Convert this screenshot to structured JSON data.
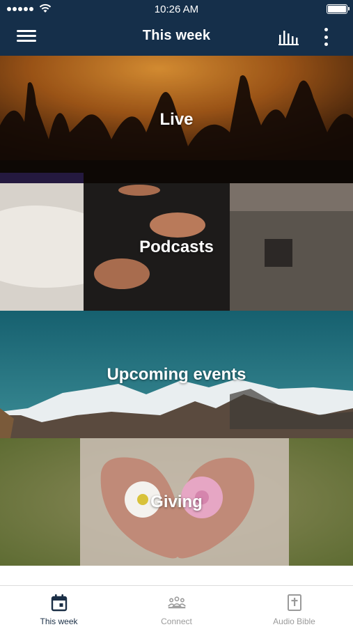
{
  "status_bar": {
    "time": "10:26 AM"
  },
  "nav": {
    "title": "This week"
  },
  "tiles": [
    {
      "label": "Live"
    },
    {
      "label": "Podcasts"
    },
    {
      "label": "Upcoming events"
    },
    {
      "label": "Giving"
    }
  ],
  "tab_bar": {
    "tabs": [
      {
        "label": "This week",
        "icon": "calendar-icon",
        "active": true
      },
      {
        "label": "Connect",
        "icon": "people-icon",
        "active": false
      },
      {
        "label": "Audio Bible",
        "icon": "bible-icon",
        "active": false
      }
    ]
  },
  "colors": {
    "nav_bg": "#152f4a",
    "active_tab": "#1b2f46",
    "inactive_tab": "#9a9a9a"
  }
}
